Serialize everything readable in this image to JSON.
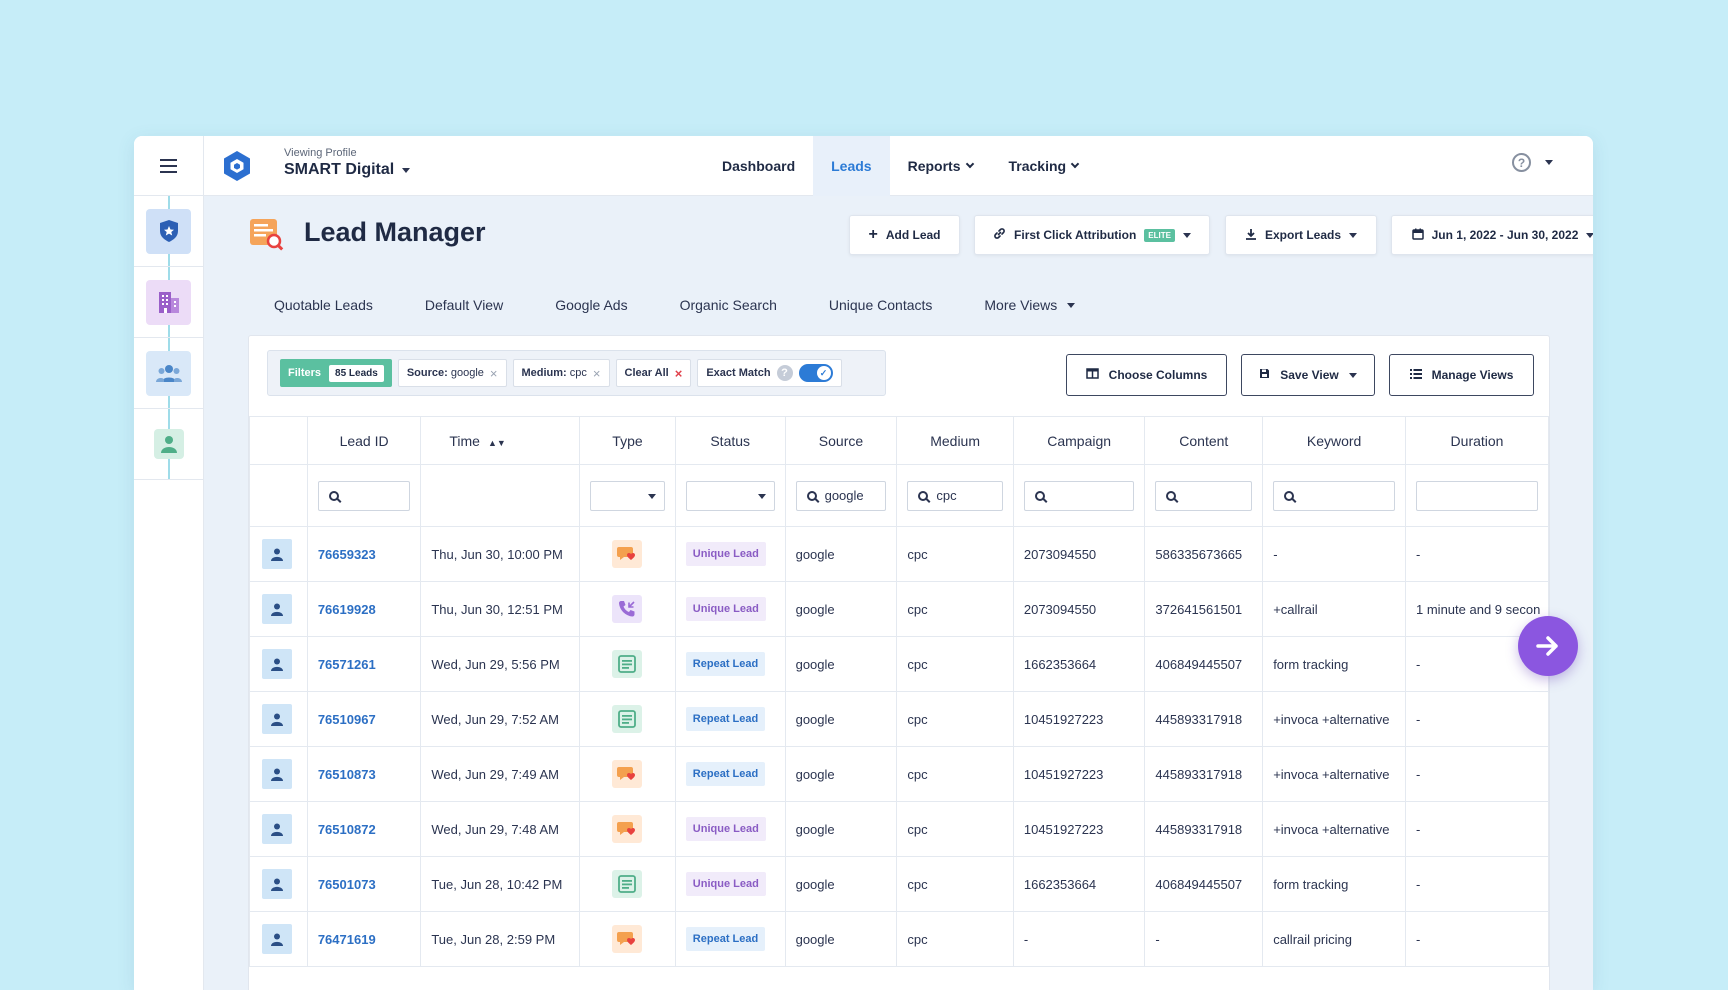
{
  "topbar": {
    "profile_label": "Viewing Profile",
    "profile_name": "SMART Digital",
    "nav": [
      {
        "label": "Dashboard"
      },
      {
        "label": "Leads"
      },
      {
        "label": "Reports"
      },
      {
        "label": "Tracking"
      }
    ],
    "help_icon": "?"
  },
  "page": {
    "title": "Lead Manager",
    "buttons": {
      "add_lead": "Add Lead",
      "attribution": "First Click Attribution",
      "elite_badge": "ELITE",
      "export": "Export Leads",
      "date_range": "Jun 1, 2022 - Jun 30, 2022"
    },
    "views": [
      "Quotable Leads",
      "Default View",
      "Google Ads",
      "Organic Search",
      "Unique Contacts",
      "More Views"
    ]
  },
  "filters": {
    "label": "Filters",
    "count": "85 Leads",
    "source_key": "Source:",
    "source_val": "google",
    "medium_key": "Medium:",
    "medium_val": "cpc",
    "clear_all": "Clear All",
    "exact_match": "Exact Match",
    "remove_glyph": "×",
    "help_glyph": "?"
  },
  "panel_buttons": {
    "choose_columns": "Choose Columns",
    "save_view": "Save View",
    "manage_views": "Manage Views"
  },
  "table": {
    "columns": [
      "Lead ID",
      "Time",
      "Type",
      "Status",
      "Source",
      "Medium",
      "Campaign",
      "Content",
      "Keyword",
      "Duration"
    ],
    "filter_values": {
      "source": "google",
      "medium": "cpc"
    },
    "rows": [
      {
        "id": "76659323",
        "time": "Thu, Jun 30, 10:00 PM",
        "type": "chat",
        "status": "Unique Lead",
        "source": "google",
        "medium": "cpc",
        "campaign": "2073094550",
        "content": "586335673665",
        "keyword": "-",
        "duration": "-"
      },
      {
        "id": "76619928",
        "time": "Thu, Jun 30, 12:51 PM",
        "type": "call",
        "status": "Unique Lead",
        "source": "google",
        "medium": "cpc",
        "campaign": "2073094550",
        "content": "372641561501",
        "keyword": "+callrail",
        "duration": "1 minute and 9 secon"
      },
      {
        "id": "76571261",
        "time": "Wed, Jun 29, 5:56 PM",
        "type": "form",
        "status": "Repeat Lead",
        "source": "google",
        "medium": "cpc",
        "campaign": "1662353664",
        "content": "406849445507",
        "keyword": "form tracking",
        "duration": "-"
      },
      {
        "id": "76510967",
        "time": "Wed, Jun 29, 7:52 AM",
        "type": "form",
        "status": "Repeat Lead",
        "source": "google",
        "medium": "cpc",
        "campaign": "10451927223",
        "content": "445893317918",
        "keyword": "+invoca +alternative",
        "duration": "-"
      },
      {
        "id": "76510873",
        "time": "Wed, Jun 29, 7:49 AM",
        "type": "chat",
        "status": "Repeat Lead",
        "source": "google",
        "medium": "cpc",
        "campaign": "10451927223",
        "content": "445893317918",
        "keyword": "+invoca +alternative",
        "duration": "-"
      },
      {
        "id": "76510872",
        "time": "Wed, Jun 29, 7:48 AM",
        "type": "chat",
        "status": "Unique Lead",
        "source": "google",
        "medium": "cpc",
        "campaign": "10451927223",
        "content": "445893317918",
        "keyword": "+invoca +alternative",
        "duration": "-"
      },
      {
        "id": "76501073",
        "time": "Tue, Jun 28, 10:42 PM",
        "type": "form",
        "status": "Unique Lead",
        "source": "google",
        "medium": "cpc",
        "campaign": "1662353664",
        "content": "406849445507",
        "keyword": "form tracking",
        "duration": "-"
      },
      {
        "id": "76471619",
        "time": "Tue, Jun 28, 2:59 PM",
        "type": "chat",
        "status": "Repeat Lead",
        "source": "google",
        "medium": "cpc",
        "campaign": "-",
        "content": "-",
        "keyword": "callrail pricing",
        "duration": "-"
      }
    ]
  },
  "colors": {
    "accent": "#2c7bd6",
    "filter_green": "#5bc0a0",
    "fab_purple": "#8b56e0",
    "background": "#c6edf8"
  }
}
